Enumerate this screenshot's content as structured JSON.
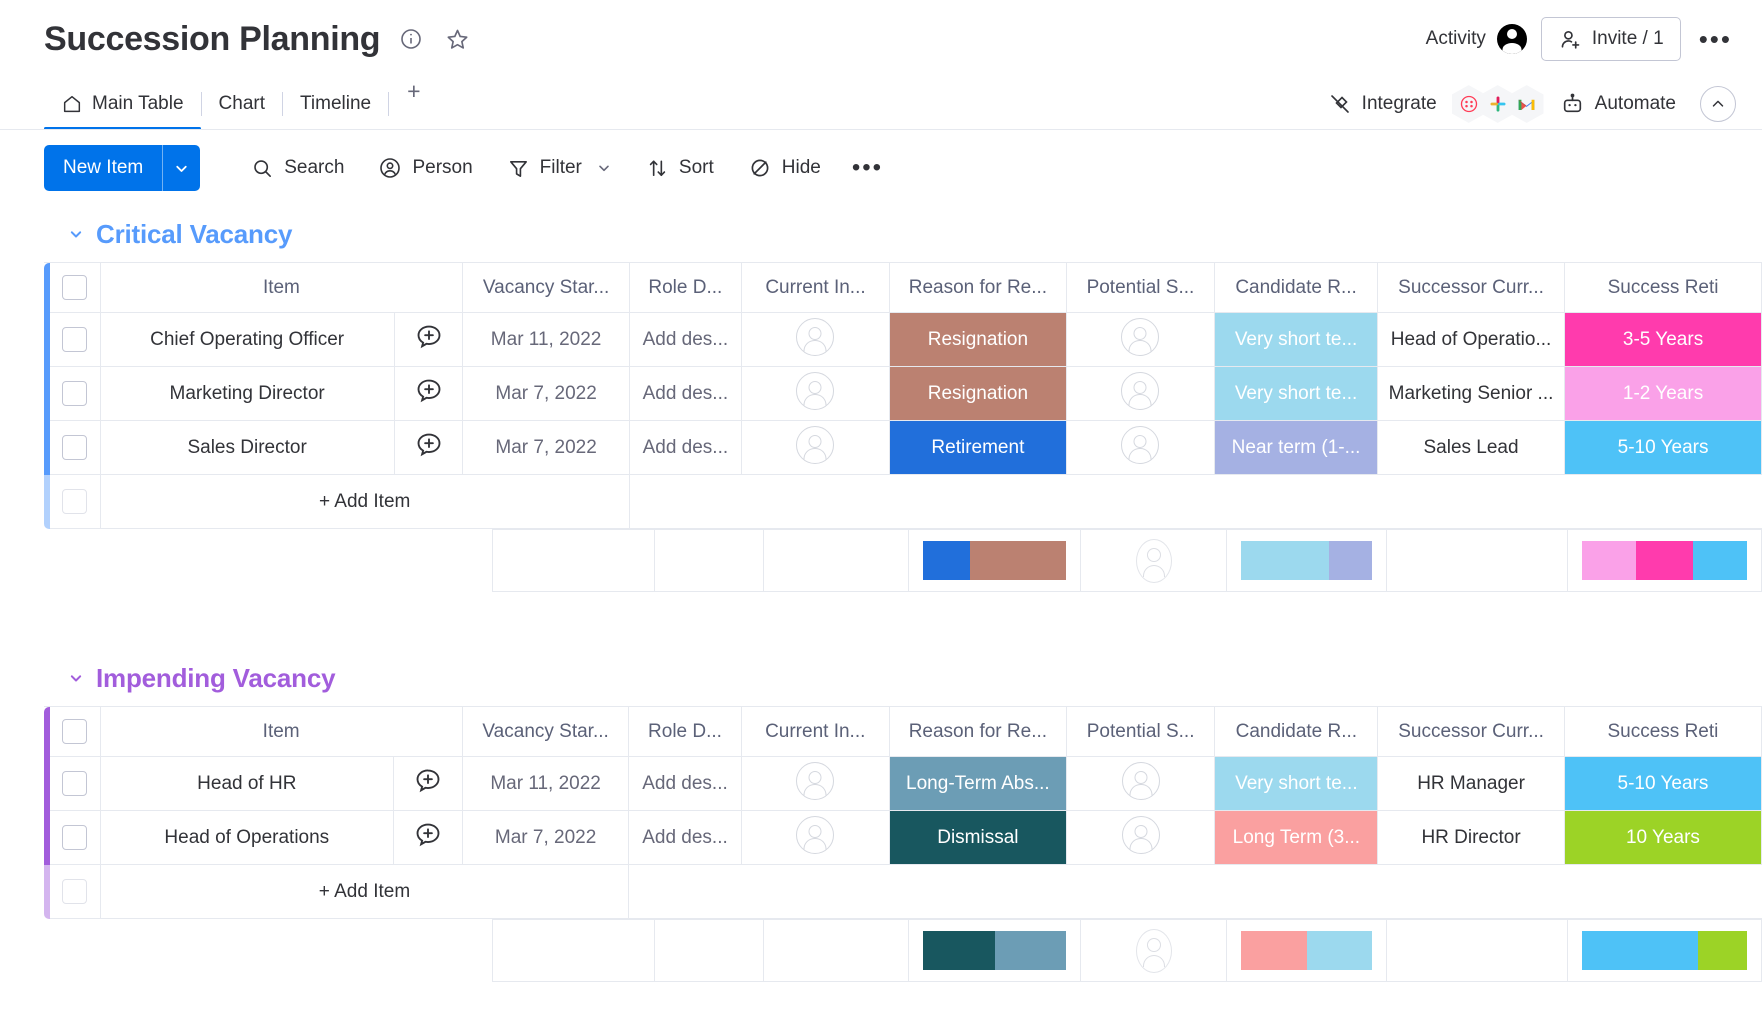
{
  "header": {
    "board_title": "Succession Planning",
    "info_icon": "info-circle-icon",
    "favorite_icon": "star-icon",
    "activity_label": "Activity",
    "invite_label": "Invite / 1",
    "more_label": "•••"
  },
  "tabs": {
    "items": [
      {
        "label": "Main Table",
        "icon": "home-icon",
        "active": true
      },
      {
        "label": "Chart",
        "active": false
      },
      {
        "label": "Timeline",
        "active": false
      }
    ],
    "add_label": "+",
    "integrate_label": "Integrate",
    "automate_label": "Automate",
    "integration_icons": [
      "monday-icon",
      "slack-icon",
      "gmail-icon"
    ],
    "collapse_icon": "chevron-up-icon"
  },
  "toolbar": {
    "new_item_label": "New Item",
    "new_item_caret": "chevron-down-icon",
    "search_label": "Search",
    "person_label": "Person",
    "filter_label": "Filter",
    "sort_label": "Sort",
    "hide_label": "Hide",
    "more_label": "•••"
  },
  "columns": [
    "Item",
    "Vacancy Star...",
    "Role D...",
    "Current In...",
    "Reason for Re...",
    "Potential S...",
    "Candidate R...",
    "Successor Curr...",
    "Success Reti"
  ],
  "add_item_label": "+ Add Item",
  "groups": [
    {
      "name": "Critical Vacancy",
      "color": "#579bfc",
      "rows": [
        {
          "item": "Chief Operating Officer",
          "vacancy_start": "Mar 11, 2022",
          "role_description": "Add des...",
          "current_incumbent": "",
          "reason": "Resignation",
          "reason_color": "#bb8171",
          "reason_dotted": false,
          "potential_successor": "",
          "candidate_readiness": "Very short te...",
          "candidate_color": "#9cd9ee",
          "candidate_dotted": false,
          "successor_current_role": "Head of Operatio...",
          "retirement": "3-5 Years",
          "retirement_color": "#ff3bad",
          "retirement_dotted": false
        },
        {
          "item": "Marketing Director",
          "vacancy_start": "Mar 7, 2022",
          "role_description": "Add des...",
          "current_incumbent": "",
          "reason": "Resignation",
          "reason_color": "#bb8171",
          "reason_dotted": false,
          "potential_successor": "",
          "candidate_readiness": "Very short te...",
          "candidate_color": "#9cd9ee",
          "candidate_dotted": false,
          "successor_current_role": "Marketing Senior ...",
          "retirement": "1-2 Years",
          "retirement_color": "#faa1e8",
          "retirement_dotted": true
        },
        {
          "item": "Sales Director",
          "vacancy_start": "Mar 7, 2022",
          "role_description": "Add des...",
          "current_incumbent": "",
          "reason": "Retirement",
          "reason_color": "#216fdb",
          "reason_dotted": false,
          "potential_successor": "",
          "candidate_readiness": "Near term (1-...",
          "candidate_color": "#a5b1e3",
          "candidate_dotted": true,
          "successor_current_role": "Sales Lead",
          "retirement": "5-10 Years",
          "retirement_color": "#4ec2f7",
          "retirement_dotted": false
        }
      ],
      "summary": {
        "reason_bar": [
          {
            "color": "#216fdb",
            "pct": 33,
            "dotted": false
          },
          {
            "color": "#bb8171",
            "pct": 67,
            "dotted": false
          }
        ],
        "candidate_bar": [
          {
            "color": "#9cd9ee",
            "pct": 67,
            "dotted": false
          },
          {
            "color": "#a5b1e3",
            "pct": 33,
            "dotted": true
          }
        ],
        "retirement_bar": [
          {
            "color": "#faa1e8",
            "pct": 33,
            "dotted": true
          },
          {
            "color": "#ff3bad",
            "pct": 34,
            "dotted": false
          },
          {
            "color": "#4ec2f7",
            "pct": 33,
            "dotted": false
          }
        ]
      }
    },
    {
      "name": "Impending Vacancy",
      "color": "#a25ddc",
      "rows": [
        {
          "item": "Head of HR",
          "vacancy_start": "Mar 11, 2022",
          "role_description": "Add des...",
          "current_incumbent": "",
          "reason": "Long-Term Abs...",
          "reason_color": "#6c9db5",
          "reason_dotted": false,
          "potential_successor": "",
          "candidate_readiness": "Very short te...",
          "candidate_color": "#9cd9ee",
          "candidate_dotted": false,
          "successor_current_role": "HR Manager",
          "retirement": "5-10 Years",
          "retirement_color": "#4ec2f7",
          "retirement_dotted": false
        },
        {
          "item": "Head of Operations",
          "vacancy_start": "Mar 7, 2022",
          "role_description": "Add des...",
          "current_incumbent": "",
          "reason": "Dismissal",
          "reason_color": "#18575f",
          "reason_dotted": false,
          "potential_successor": "",
          "candidate_readiness": "Long Term (3...",
          "candidate_color": "#faa0a0",
          "candidate_dotted": false,
          "successor_current_role": "HR Director",
          "retirement": "10 Years",
          "retirement_color": "#9cd326",
          "retirement_dotted": false
        }
      ],
      "summary": {
        "reason_bar": [
          {
            "color": "#18575f",
            "pct": 50,
            "dotted": false
          },
          {
            "color": "#6c9db5",
            "pct": 50,
            "dotted": false
          }
        ],
        "candidate_bar": [
          {
            "color": "#faa0a0",
            "pct": 50,
            "dotted": false
          },
          {
            "color": "#9cd9ee",
            "pct": 50,
            "dotted": false
          }
        ],
        "retirement_bar": [
          {
            "color": "#4ec2f7",
            "pct": 70,
            "dotted": false
          },
          {
            "color": "#9cd326",
            "pct": 30,
            "dotted": false
          }
        ]
      }
    }
  ]
}
